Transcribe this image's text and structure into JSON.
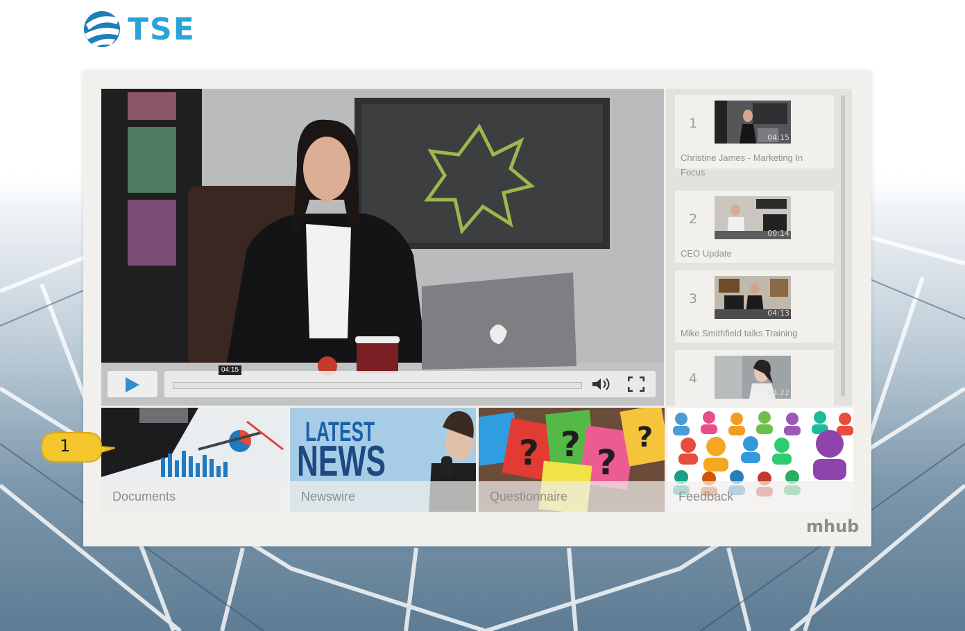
{
  "header": {
    "logo_text": "TSE"
  },
  "player": {
    "current_time": "04:15",
    "state": "paused"
  },
  "playlist": {
    "items": [
      {
        "number": "1",
        "title": "Christine James - Marketing In Focus",
        "duration": "04:15"
      },
      {
        "number": "2",
        "title": "CEO Update",
        "duration": "00:14"
      },
      {
        "number": "3",
        "title": "Mike Smithfield talks Training",
        "duration": "04:13"
      },
      {
        "number": "4",
        "title": "",
        "duration": "04:22"
      }
    ]
  },
  "tiles": [
    {
      "label": "Documents"
    },
    {
      "label": "Newswire",
      "image_text_1": "LATEST",
      "image_text_2": "NEWS"
    },
    {
      "label": "Questionnaire"
    },
    {
      "label": "Feedback"
    }
  ],
  "callout": {
    "number": "1"
  },
  "footer": {
    "brand": "mhub"
  },
  "colors": {
    "logo_blue": "#29a3d8",
    "play_blue": "#2f8fd0",
    "panel": "#f1f0ec"
  }
}
